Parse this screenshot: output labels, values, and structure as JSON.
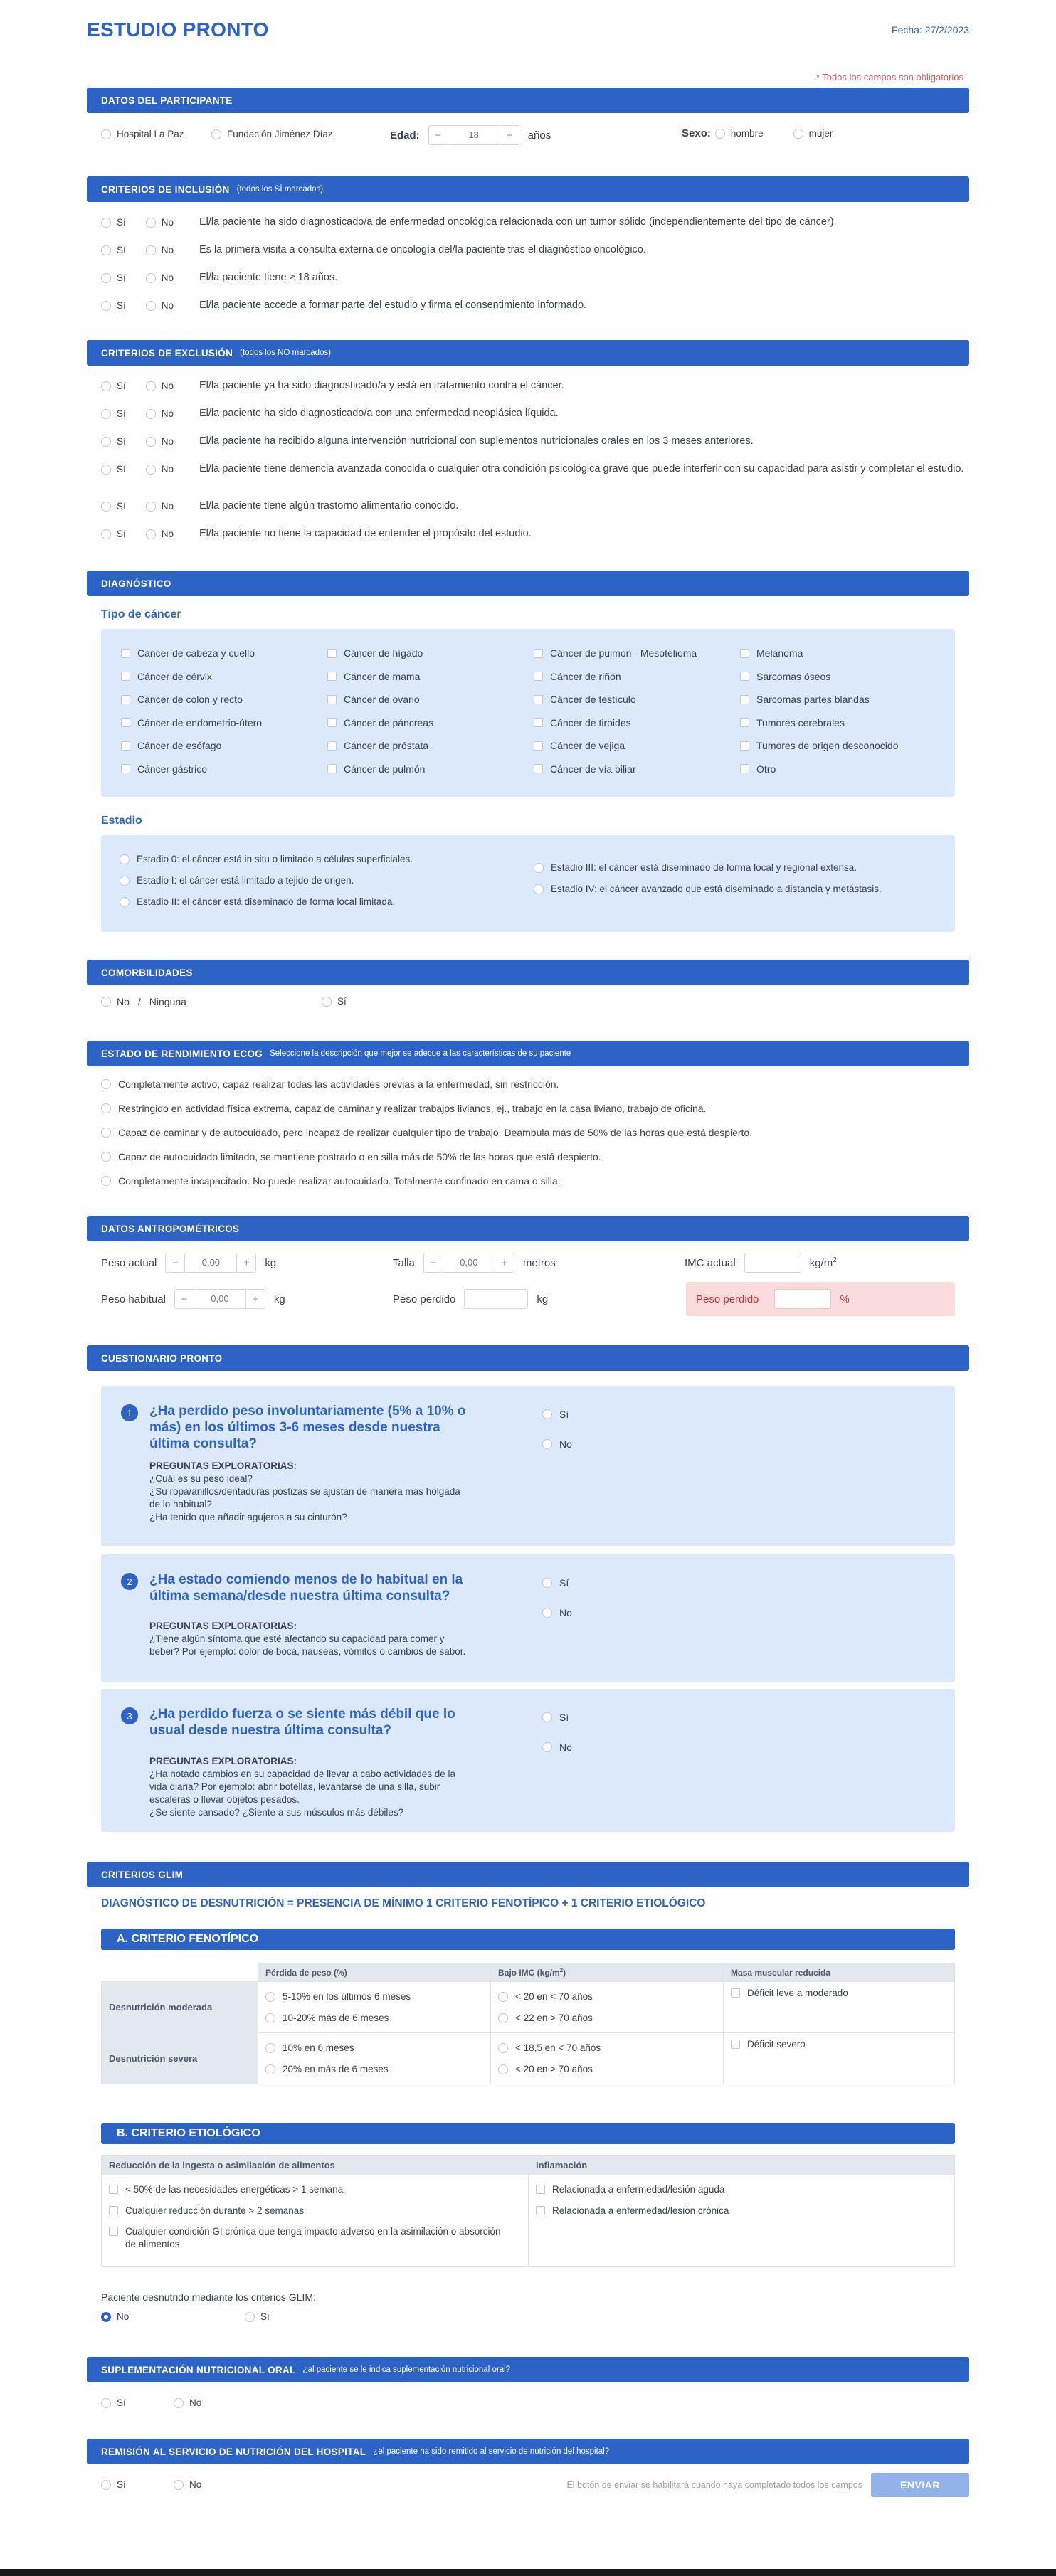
{
  "header": {
    "title": "ESTUDIO PRONTO",
    "date": "Fecha: 27/2/2023",
    "required": "* Todos los campos son obligatorios"
  },
  "participant": {
    "title": "DATOS DEL PARTICIPANTE",
    "hospital1": "Hospital La Paz",
    "hospital2": "Fundación Jiménez Díaz",
    "age_label": "Edad:",
    "age_value": "18",
    "age_unit": "años",
    "sex_label": "Sexo:",
    "sex1": "hombre",
    "sex2": "mujer"
  },
  "yes": "Sí",
  "no": "No",
  "inclusion": {
    "title": "CRITERIOS DE INCLUSIÓN",
    "sub": "(todos los SÍ marcados)",
    "items": [
      "El/la paciente ha sido diagnosticado/a de enfermedad oncológica relacionada con un tumor sólido (independientemente del tipo de cáncer).",
      "Es la primera visita a consulta externa de oncología del/la paciente tras el diagnóstico oncológico.",
      "El/la paciente tiene ≥ 18 años.",
      "El/la paciente accede a formar parte del estudio y firma el consentimiento informado."
    ]
  },
  "exclusion": {
    "title": "CRITERIOS DE EXCLUSIÓN",
    "sub": "(todos los NO marcados)",
    "items": [
      "El/la paciente ya ha sido diagnosticado/a y está en tratamiento contra el cáncer.",
      "El/la paciente ha sido diagnosticado/a con una enfermedad neoplásica líquida.",
      "El/la paciente ha recibido alguna intervención nutricional con suplementos nutricionales orales en los 3 meses anteriores.",
      "El/la paciente tiene demencia avanzada conocida o cualquier otra condición psicológica grave que puede interferir con su capacidad para asistir y completar el estudio.",
      "El/la paciente tiene algún trastorno alimentario conocido.",
      "El/la paciente no tiene la capacidad de entender el propósito del estudio."
    ]
  },
  "diagnosis": {
    "title": "DIAGNÓSTICO",
    "cancer_heading": "Tipo de cáncer",
    "cancers": [
      [
        "Cáncer de cabeza y cuello",
        "Cáncer de cérvix",
        "Cáncer de colon y recto",
        "Cáncer de endometrio-útero",
        "Cáncer de esófago",
        "Cáncer gástrico"
      ],
      [
        "Cáncer de hígado",
        "Cáncer de mama",
        "Cáncer de ovario",
        "Cáncer de páncreas",
        "Cáncer de próstata",
        "Cáncer de pulmón"
      ],
      [
        "Cáncer de pulmón - Mesotelioma",
        "Cáncer de riñón",
        "Cáncer de testículo",
        "Cáncer de tiroides",
        "Cáncer de vejiga",
        "Cáncer de vía biliar"
      ],
      [
        "Melanoma",
        "Sarcomas óseos",
        "Sarcomas partes blandas",
        "Tumores cerebrales",
        "Tumores de origen desconocido",
        "Otro"
      ]
    ],
    "stage_heading": "Estadio",
    "stages_left": [
      "Estadio 0: el cáncer está in situ o limitado a células superficiales.",
      "Estadio I: el cáncer está limitado a tejido de origen.",
      "Estadio II: el cáncer está diseminado de forma local limitada."
    ],
    "stages_right": [
      "Estadio III: el cáncer está diseminado de forma local y regional extensa.",
      "Estadio IV: el cáncer avanzado que está diseminado a distancia y metástasis."
    ]
  },
  "comorb": {
    "title": "COMORBILIDADES",
    "no": "No",
    "sep": "/",
    "none": "Ninguna",
    "yes": "Sí"
  },
  "ecog": {
    "title": "ESTADO DE RENDIMIENTO ECOG",
    "sub": "Seleccione la descripción que mejor se adecue a las características de su paciente",
    "items": [
      "Completamente activo, capaz realizar todas las actividades previas a la enfermedad, sin restricción.",
      "Restringido en actividad física extrema, capaz de caminar y realizar trabajos livianos, ej., trabajo en la casa liviano, trabajo de oficina.",
      "Capaz de caminar y de autocuidado, pero incapaz de realizar cualquier tipo de trabajo. Deambula más de 50% de las horas que está despierto.",
      "Capaz de autocuidado limitado, se mantiene postrado o en silla más de 50% de las horas que está despierto.",
      "Completamente incapacitado. No puede realizar autocuidado. Totalmente confinado en cama o silla."
    ]
  },
  "anthro": {
    "title": "DATOS ANTROPOMÉTRICOS",
    "weight_label": "Peso actual",
    "weight": "0,00",
    "kg": "kg",
    "height_label": "Talla",
    "height": "0,00",
    "m": "metros",
    "bmi_label": "IMC actual",
    "bmi_unit": "kg/m",
    "bmi_sup": "2",
    "habit_label": "Peso habitual",
    "habit": "0,00",
    "lost_label": "Peso perdido",
    "lost_pct_label": "Peso perdido",
    "pct": "%"
  },
  "pronto": {
    "title": "CUESTIONARIO PRONTO",
    "questions": [
      {
        "n": "1",
        "title": "¿Ha perdido peso involuntariamente (5% a 10% o más) en los últimos 3-6 meses desde nuestra última consulta?",
        "exp": "PREGUNTAS EXPLORATORIAS:",
        "lines": [
          "¿Cuál es su peso ideal?",
          "¿Su ropa/anillos/dentaduras postizas se ajustan de manera más holgada de lo habitual?",
          "¿Ha tenido que añadir agujeros a su cinturón?"
        ]
      },
      {
        "n": "2",
        "title": "¿Ha estado comiendo menos de lo habitual en la última semana/desde nuestra última consulta?",
        "exp": "PREGUNTAS EXPLORATORIAS:",
        "lines": [
          "¿Tiene algún síntoma que esté afectando su capacidad para comer y beber? Por ejemplo: dolor de boca, náuseas, vómitos o cambios de sabor."
        ]
      },
      {
        "n": "3",
        "title": "¿Ha perdido fuerza o se siente más débil que lo usual desde nuestra última consulta?",
        "exp": "PREGUNTAS EXPLORATORIAS:",
        "lines": [
          "¿Ha notado cambios en su capacidad de llevar a cabo actividades de la vida diaria? Por ejemplo: abrir botellas, levantarse de una silla, subir escaleras o llevar objetos pesados.",
          "¿Se siente cansado? ¿Siente a sus músculos más débiles?"
        ]
      }
    ]
  },
  "glim": {
    "title": "CRITERIOS GLIM",
    "formula": "DIAGNÓSTICO DE DESNUTRICIÓN = PRESENCIA DE MÍNIMO 1 CRITERIO FENOTÍPICO + 1 CRITERIO ETIOLÓGICO",
    "a_title": "A. CRITERIO FENOTÍPICO",
    "cols": [
      "Pérdida de peso (%)",
      "Bajo IMC (kg/m",
      "Masa muscular reducida"
    ],
    "moderate": "Desnutrición moderada",
    "severe": "Desnutrición severa",
    "mod_weight": [
      "5-10% en los últimos 6 meses",
      "10-20% más de 6 meses"
    ],
    "mod_bmi": [
      "< 20 en < 70 años",
      "< 22 en > 70 años"
    ],
    "mod_muscle": "Déficit leve a moderado",
    "sev_weight": [
      "10% en 6 meses",
      "20% en más de 6 meses"
    ],
    "sev_bmi": [
      "< 18,5 en < 70 años",
      "< 20 en > 70 años"
    ],
    "sev_muscle": "Déficit severo",
    "b_title": "B. CRITERIO ETIOLÓGICO",
    "intake_head": "Reducción de la ingesta o asimilación de alimentos",
    "inflam_head": "Inflamación",
    "intake": [
      "< 50% de las necesidades energéticas > 1 semana",
      "Cualquier reducción durante > 2 semanas",
      "Cualquier condición GI crónica que tenga impacto adverso en la asimilación o absorción de alimentos"
    ],
    "inflam": [
      "Relacionada a enfermedad/lesión aguda",
      "Relacionada a enfermedad/lesión crónica"
    ],
    "result_label": "Paciente desnutrido mediante los criterios GLIM:",
    "result_no": "No",
    "result_yes": "Sí"
  },
  "supp": {
    "title": "SUPLEMENTACIÓN NUTRICIONAL ORAL",
    "sub": "¿al paciente se le indica suplementación nutricional oral?"
  },
  "remit": {
    "title": "REMISIÓN AL SERVICIO DE NUTRICIÓN DEL HOSPITAL",
    "sub": "¿el paciente ha sido remitido al servicio de nutrición del hospital?"
  },
  "footer": {
    "note": "El botón de enviar se habilitará cuando haya completado todos los campos",
    "send": "ENVIAR"
  }
}
